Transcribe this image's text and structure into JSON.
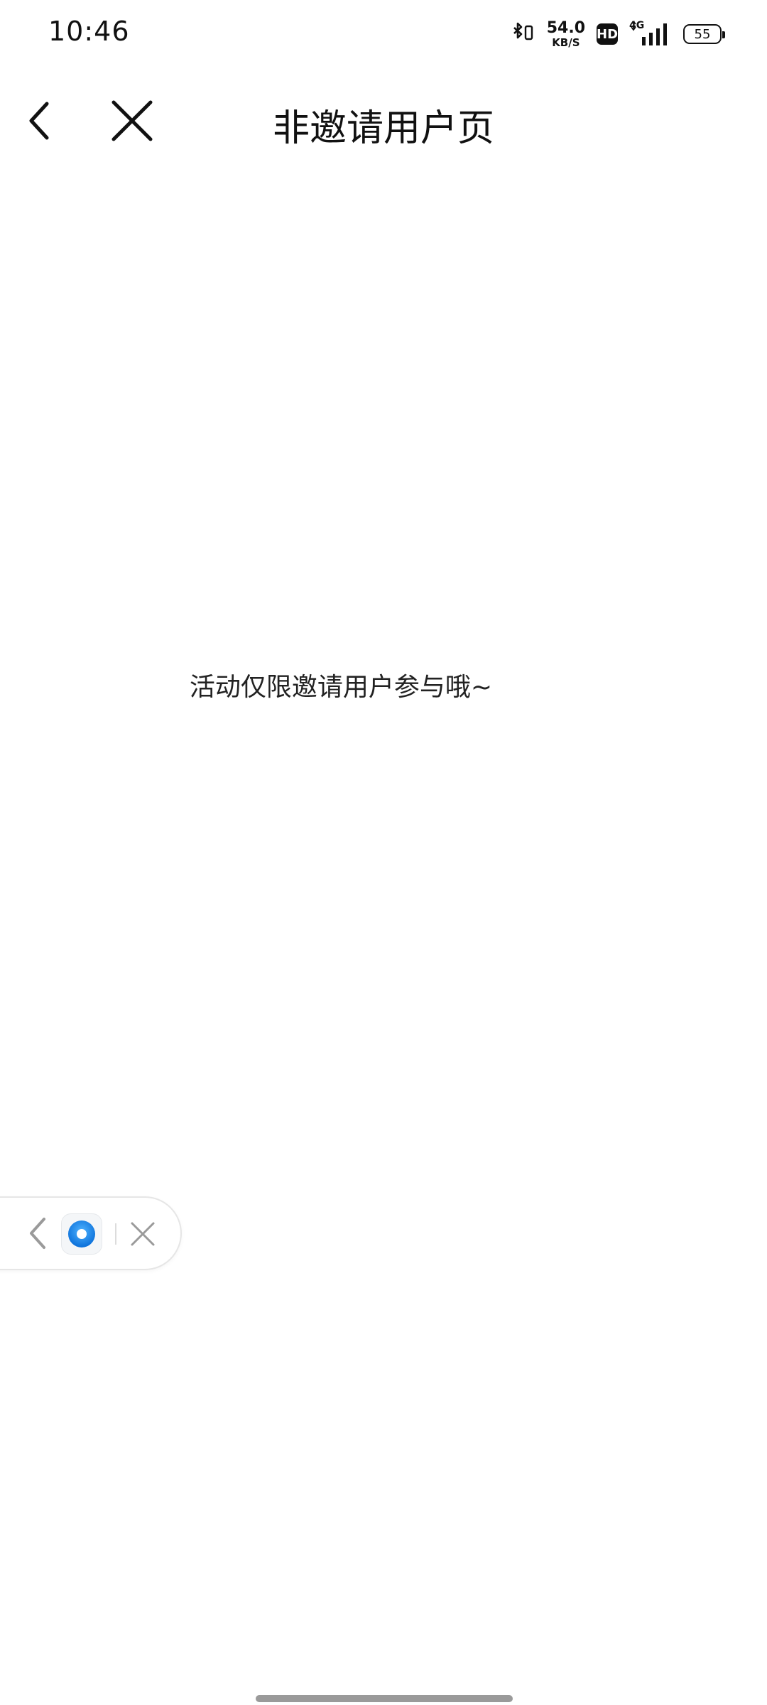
{
  "status_bar": {
    "time": "10:46",
    "net_speed_value": "54.0",
    "net_speed_unit": "KB/S",
    "hd_label": "HD",
    "network_label": "4G",
    "battery_level": "55",
    "icons": [
      "bluetooth-icon",
      "hd-icon",
      "signal-icon",
      "battery-icon"
    ]
  },
  "header": {
    "title": "非邀请用户页",
    "back_icon": "chevron-left-icon",
    "close_icon": "close-icon"
  },
  "main": {
    "message": "活动仅限邀请用户参与哦~"
  },
  "floating_capsule": {
    "back_icon": "chevron-left-icon",
    "app_icon": "app-icon",
    "close_icon": "close-icon",
    "accent_color": "#1a8cff"
  }
}
